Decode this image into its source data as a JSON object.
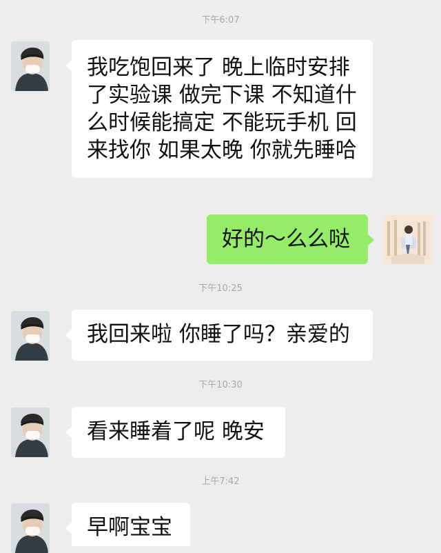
{
  "messages": [
    {
      "type": "time",
      "text": "下午6:07"
    },
    {
      "type": "incoming",
      "text": "我吃饱回来了 晚上临时安排了实验课 做完下课 不知道什么时候能搞定 不能玩手机 回来找你 如果太晚 你就先睡哈"
    },
    {
      "type": "outgoing",
      "text": "好的～么么哒"
    },
    {
      "type": "time",
      "text": "下午10:25"
    },
    {
      "type": "incoming",
      "text": "我回来啦 你睡了吗？亲爱的"
    },
    {
      "type": "time",
      "text": "下午10:30"
    },
    {
      "type": "incoming",
      "text": "看来睡着了呢 晚安"
    },
    {
      "type": "time",
      "text": "上午7:42"
    },
    {
      "type": "incoming",
      "text": "早啊宝宝"
    }
  ],
  "colors": {
    "background": "#ededed",
    "incoming_bubble": "#ffffff",
    "outgoing_bubble": "#95ec69",
    "timestamp": "#a9a9a9"
  }
}
